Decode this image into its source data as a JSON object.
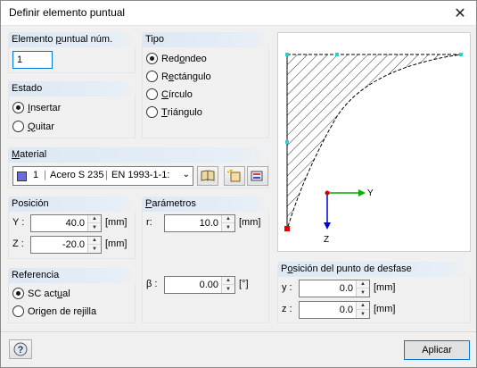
{
  "window": {
    "title": "Definir elemento puntual"
  },
  "groups": {
    "element_num": {
      "label_pre": "Elemento ",
      "label_ul": "p",
      "label_post": "untual núm.",
      "value": "1"
    },
    "estado": {
      "label": "Estado",
      "options": [
        {
          "label_ul": "I",
          "label_post": "nsertar",
          "selected": true
        },
        {
          "label_ul": "Q",
          "label_post": "uitar",
          "selected": false
        }
      ]
    },
    "tipo": {
      "label": "Tipo",
      "options": [
        {
          "label_pre": "Red",
          "label_ul": "o",
          "label_post": "ndeo",
          "selected": true
        },
        {
          "label_pre": "R",
          "label_ul": "e",
          "label_post": "ctángulo",
          "selected": false
        },
        {
          "label_pre": "",
          "label_ul": "C",
          "label_post": "írculo",
          "selected": false
        },
        {
          "label_pre": "",
          "label_ul": "T",
          "label_post": "riángulo",
          "selected": false
        }
      ]
    },
    "material": {
      "label_ul": "M",
      "label_post": "aterial",
      "number": "1",
      "name": "Acero S 235",
      "norm": "EN 1993-1-1:",
      "color": "#6b6be0"
    },
    "posicion": {
      "label": "Posición",
      "y_label": "Y :",
      "y_value": "40.0",
      "y_unit": "[mm]",
      "z_label": "Z :",
      "z_value": "-20.0",
      "z_unit": "[mm]"
    },
    "parametros": {
      "label_ul": "P",
      "label_post": "arámetros",
      "r_label": "r:",
      "r_value": "10.0",
      "r_unit": "[mm]",
      "beta_label": "β :",
      "beta_value": "0.00",
      "beta_unit": "[°]"
    },
    "referencia": {
      "label": "Referencia",
      "options": [
        {
          "label_pre": "SC act",
          "label_ul": "u",
          "label_post": "al",
          "selected": true
        },
        {
          "label_pre": "Origen de re",
          "label_ul": "j",
          "label_post": "illa",
          "selected": false
        }
      ]
    },
    "desfase": {
      "label_pre": "P",
      "label_ul": "o",
      "label_post": "sición del punto de desfase",
      "y_label": "y :",
      "y_value": "0.0",
      "y_unit": "[mm]",
      "z_label": "z :",
      "z_value": "0.0",
      "z_unit": "[mm]"
    }
  },
  "preview": {
    "axis_y": "Y",
    "axis_z": "Z"
  },
  "footer": {
    "apply_label": "Aplicar",
    "help_icon": "help-icon"
  }
}
